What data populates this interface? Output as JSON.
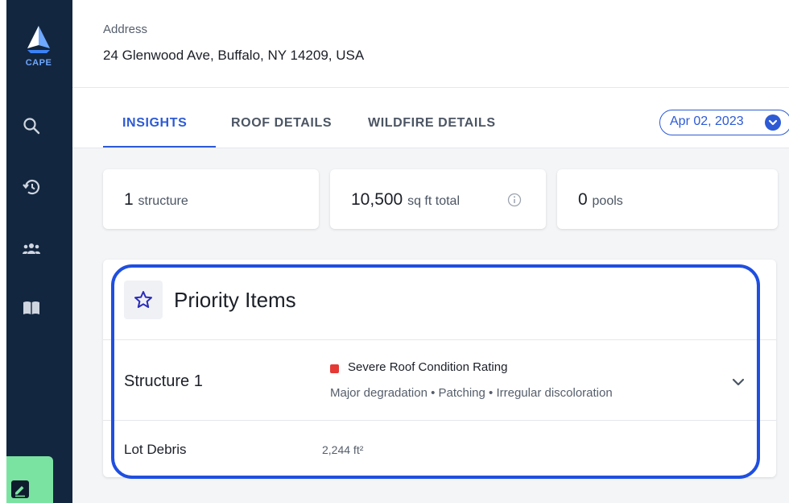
{
  "sidebar": {
    "logo_text": "CAPE",
    "nav": [
      {
        "icon": "search-icon"
      },
      {
        "icon": "history-icon"
      },
      {
        "icon": "users-icon"
      },
      {
        "icon": "book-icon"
      }
    ],
    "feedback_icon": "feedback-icon"
  },
  "address": {
    "label": "Address",
    "value": "24 Glenwood Ave, Buffalo, NY 14209, USA"
  },
  "tabs": [
    {
      "label": "INSIGHTS",
      "active": true
    },
    {
      "label": "ROOF DETAILS",
      "active": false
    },
    {
      "label": "WILDFIRE DETAILS",
      "active": false
    }
  ],
  "date_selector": {
    "value": "Apr 02, 2023"
  },
  "stats": [
    {
      "number": "1",
      "unit": "structure"
    },
    {
      "number": "10,500",
      "unit": "sq ft total",
      "info_icon": "info-icon"
    },
    {
      "number": "0",
      "unit": "pools"
    }
  ],
  "priority": {
    "title": "Priority Items",
    "icon": "star-icon",
    "items": [
      {
        "name": "Structure 1",
        "severity": "Severe Roof Condition Rating",
        "details": "Major degradation • Patching • Irregular discoloration"
      },
      {
        "name": "Lot Debris",
        "value": "2,244 ft²"
      }
    ]
  },
  "colors": {
    "sidebar": "#13263f",
    "accent": "#2d5bd6",
    "severity": "#e53935",
    "focus_ring": "#1f4fe0",
    "feedback": "#7be3a2"
  }
}
